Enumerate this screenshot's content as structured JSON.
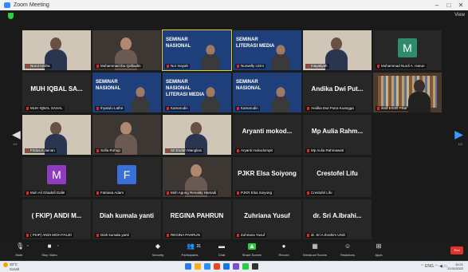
{
  "window": {
    "title": "Zoom Meeting",
    "controls": [
      "–",
      "□",
      "✕"
    ]
  },
  "meeting": {
    "view_label": "View"
  },
  "grid": {
    "rows": [
      [
        {
          "type": "video",
          "tone": "light",
          "label": "Nurul Amiha"
        },
        {
          "type": "video",
          "tone": "dark",
          "label": "Muhammad Ibu Qolbudin"
        },
        {
          "type": "banner",
          "tone": "blue",
          "label": "Nur Inayah",
          "banner": "SEMINAR NASIONAL"
        },
        {
          "type": "banner",
          "tone": "blue",
          "label": "Nurwelly Uzmi",
          "banner": "SEMINAR LITERASI MEDIA"
        },
        {
          "type": "video",
          "tone": "light",
          "label": "Inayatiyah"
        },
        {
          "type": "avatar",
          "letter": "M",
          "color": "#2e8b6e",
          "label": "Muhammad Nurdi A. Harun"
        }
      ],
      [
        {
          "type": "name",
          "name": "MUH IQBAL SA...",
          "label": "MUH IQBAL SAHAL"
        },
        {
          "type": "banner",
          "tone": "blue",
          "label": "Ihyatulu Lathe",
          "banner": "SEMINAR NASIONAL"
        },
        {
          "type": "banner",
          "tone": "blue",
          "label": "Kamarudin",
          "banner": "SEMINAR NASIONAL LITERASI MEDIA"
        },
        {
          "type": "banner",
          "tone": "blue",
          "label": "Kamarudin",
          "banner": "SEMINAR NASIONAL"
        },
        {
          "type": "name",
          "name": "Andika Dwi Put...",
          "label": "Andika Dwi Putra Kuangga"
        },
        {
          "type": "shelf",
          "label": "andi Endrit Fikal"
        }
      ],
      [
        {
          "type": "video",
          "tone": "light",
          "label": "Fridos A Jainan"
        },
        {
          "type": "video",
          "tone": "dark",
          "label": "Sofia Rohup"
        },
        {
          "type": "video",
          "tone": "light",
          "label": "Sri Endah Manglias"
        },
        {
          "type": "name",
          "name": "Aryanti mokod...",
          "label": "Aryanti mokodompit"
        },
        {
          "type": "name",
          "name": "Mp Aulia Rahm...",
          "label": "Mp Aulia Rahmawati"
        },
        {
          "type": "empty",
          "label": ""
        }
      ],
      [
        {
          "type": "avatar",
          "letter": "M",
          "color": "#8e3bbf",
          "label": "Muh Ali Ghadafi Dalle"
        },
        {
          "type": "avatar",
          "letter": "F",
          "color": "#3a6fd8",
          "label": "Fatriasa Adam"
        },
        {
          "type": "video",
          "tone": "dark",
          "label": "Moh Agung Renaldy Hamadi"
        },
        {
          "type": "name",
          "name": "PJKR Elsa Soiyong",
          "label": "PJKR Elsa Soiyong"
        },
        {
          "type": "name",
          "name": "Crestofel Lifu",
          "label": "Crestofel Lifu"
        },
        {
          "type": "empty",
          "label": ""
        }
      ],
      [
        {
          "type": "name",
          "name": "( FKIP) ANDI M...",
          "label": "( FKIP) ANDI MOH FAUZI"
        },
        {
          "type": "name",
          "name": "Diah kumala yanti",
          "label": "Diah kumala yanti"
        },
        {
          "type": "name",
          "name": "REGINA PAHRUN",
          "label": "REGINA PAHRUN"
        },
        {
          "type": "name",
          "name": "Zuhriana Yusuf",
          "label": "Zuhriana Yusuf"
        },
        {
          "type": "name",
          "name": "dr. Sri A.Ibrahi...",
          "label": "dr. Sri A.Ibrahim UNG"
        },
        {
          "type": "empty",
          "label": ""
        }
      ]
    ],
    "page_left": "1/2",
    "page_right": "1/2"
  },
  "toolbar": {
    "items": [
      {
        "key": "mute",
        "label": "Mute",
        "icon": "microphone-icon",
        "glyph": "🎙",
        "color": "#e8e8e8"
      },
      {
        "key": "video",
        "label": "Stop Video",
        "icon": "camera-icon",
        "glyph": "■",
        "color": "#e8e8e8"
      },
      {
        "key": "security",
        "label": "Security",
        "icon": "shield-icon",
        "glyph": "◆",
        "color": "#e8e8e8"
      },
      {
        "key": "participants",
        "label": "Participants",
        "icon": "participants-icon",
        "glyph": "👥",
        "color": "#e8e8e8"
      },
      {
        "key": "chat",
        "label": "Chat",
        "icon": "chat-icon",
        "glyph": "▬",
        "color": "#e8e8e8"
      },
      {
        "key": "share",
        "label": "Share Screen",
        "icon": "share-screen-icon",
        "glyph": "▲",
        "color": "#2ecc40"
      },
      {
        "key": "record",
        "label": "Record",
        "icon": "record-icon",
        "glyph": "●",
        "color": "#e8e8e8"
      },
      {
        "key": "breakout",
        "label": "Breakout Rooms",
        "icon": "breakout-rooms-icon",
        "glyph": "▦",
        "color": "#e8e8e8"
      },
      {
        "key": "reactions",
        "label": "Reactions",
        "icon": "reactions-icon",
        "glyph": "☺",
        "color": "#e8e8e8"
      },
      {
        "key": "apps",
        "label": "Apps",
        "icon": "apps-icon",
        "glyph": "⊞",
        "color": "#e8e8e8"
      }
    ],
    "participant_count": "31",
    "end_label": "End"
  },
  "taskbar": {
    "temperature": "30°C",
    "weather": "Cerah",
    "language": "ENG",
    "region": "US",
    "time": "10:21",
    "date": "21/11/2022",
    "app_colors": [
      "#2d7be5",
      "#f2b01e",
      "#2d8cff",
      "#e04a2a",
      "#1a73e8",
      "#7a4fd0",
      "#2ecc40",
      "#333333"
    ]
  },
  "colors": {
    "active_speaker": "#e8d600",
    "muted": "#e02828",
    "end_button": "#e0332a"
  }
}
